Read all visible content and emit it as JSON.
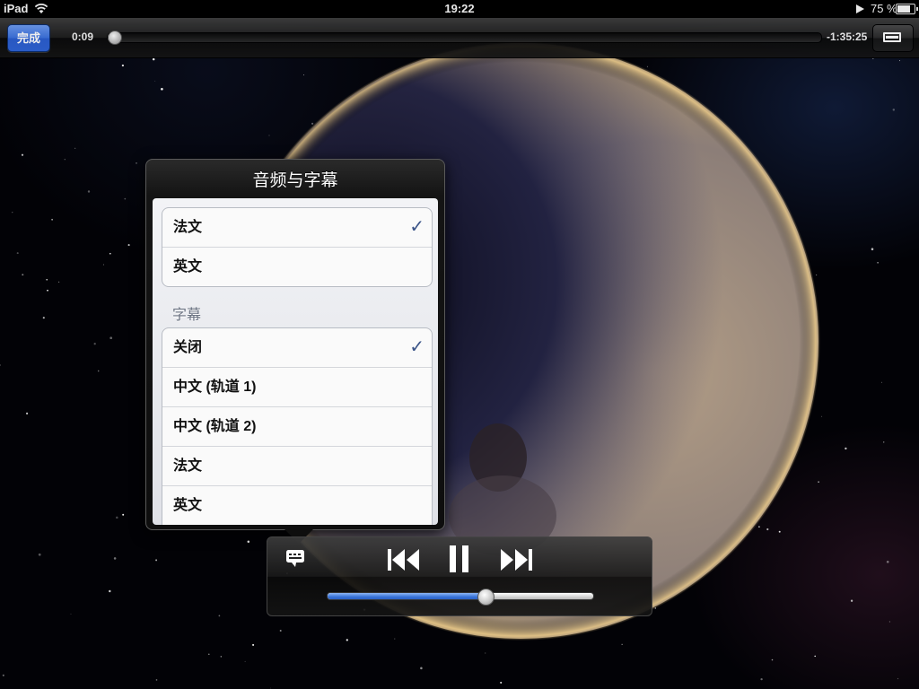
{
  "status_bar": {
    "device": "iPad",
    "time": "19:22",
    "battery": "75 %"
  },
  "nav": {
    "done_label": "完成",
    "elapsed": "0:09",
    "remaining": "-1:35:25",
    "playback_progress": 0.0016
  },
  "popover": {
    "title": "音频与字幕",
    "audio_tracks": [
      {
        "label": "法文",
        "selected": true
      },
      {
        "label": "英文",
        "selected": false
      }
    ],
    "subtitles_header": "字幕",
    "subtitle_tracks": [
      {
        "label": "关闭",
        "selected": true
      },
      {
        "label": "中文 (轨道 1)",
        "selected": false
      },
      {
        "label": "中文 (轨道 2)",
        "selected": false
      },
      {
        "label": "法文",
        "selected": false
      },
      {
        "label": "英文",
        "selected": false
      }
    ],
    "check_glyph": "✓"
  },
  "controls": {
    "volume": 0.59,
    "icons": [
      "subtitles-icon",
      "previous-track-icon",
      "pause-icon",
      "next-track-icon"
    ]
  },
  "colors": {
    "accent_blue": "#3c72e0",
    "checkmark": "#3b5488",
    "volume_fill": "#3a74d8"
  }
}
